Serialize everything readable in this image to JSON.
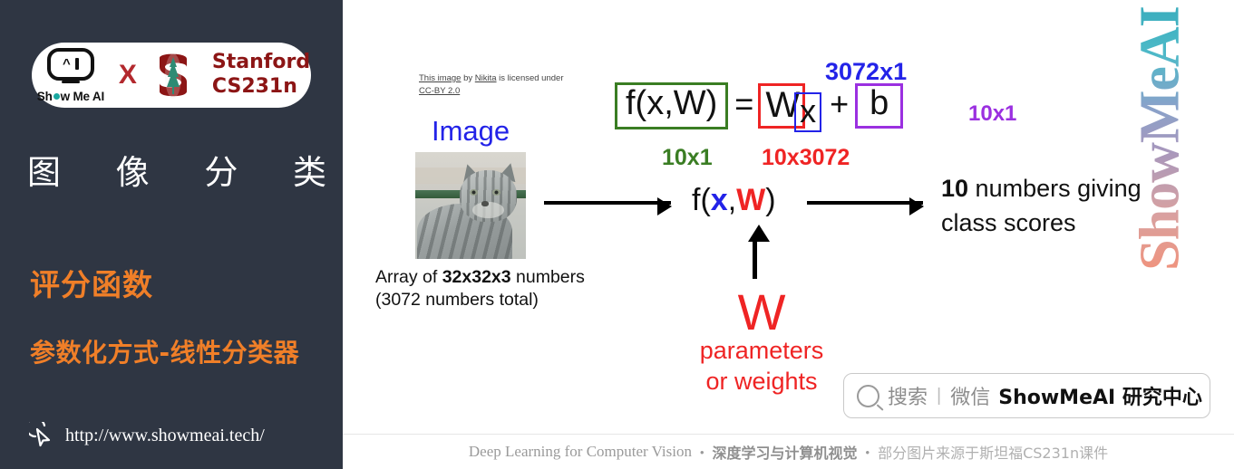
{
  "sidebar": {
    "badge": {
      "smai_word_1": "Sh",
      "smai_word_2": "w Me AI",
      "robot_caret": "^",
      "x_mark": "X",
      "stanford_line1": "Stanford",
      "stanford_line2": "CS231n"
    },
    "cn_title_chars": [
      "图",
      "像",
      "分",
      "类"
    ],
    "topic_1": "评分函数",
    "topic_2": "参数化方式-线性分类器",
    "site_url": "http://www.showmeai.tech/"
  },
  "main": {
    "credit": {
      "link1": "This image",
      "mid1": " by ",
      "link2": "Nikita",
      "mid2": " is licensed under ",
      "link3": "CC-BY 2.0"
    },
    "image_label": "Image",
    "array_line1_pre": "Array of ",
    "array_line1_bold": "32x32x3",
    "array_line1_post": " numbers",
    "array_line2": "(3072 numbers total)",
    "formula": {
      "lhs": "f(x,W)",
      "equals": "=",
      "w": "W",
      "x": "x",
      "plus": "+",
      "b": "b",
      "label_3072x1": "3072x1",
      "label_10x1_b": "10x1",
      "label_10x1_f": "10x1",
      "label_10x3072": "10x3072"
    },
    "fxw": {
      "f_open": "f(",
      "x": "x",
      "comma": ",",
      "w": "W",
      "close": ")"
    },
    "scores_bold": "10",
    "scores_rest": " numbers giving",
    "scores_line2": "class scores",
    "w_big": "W",
    "w_param_1": "parameters",
    "w_param_2": "or weights",
    "search": {
      "placeholder_gray": "搜索",
      "separator": "|",
      "wechat": "微信",
      "brand": "ShowMeAI 研究中心"
    },
    "watermark": "ShowMeAI",
    "footer": {
      "en": "Deep Learning for Computer Vision",
      "dot1": "•",
      "cn_bold": "深度学习与计算机视觉",
      "dot2": "•",
      "cn_gray": "部分图片来源于斯坦福CS231n课件"
    }
  },
  "colors": {
    "sidebar_bg": "#2f3643",
    "accent_orange": "#f07f28",
    "green_box": "#3a7d23",
    "red_box": "#ef2424",
    "blue_box": "#2323e8",
    "purple_box": "#9b30e0",
    "stanford_red": "#8c1515"
  }
}
